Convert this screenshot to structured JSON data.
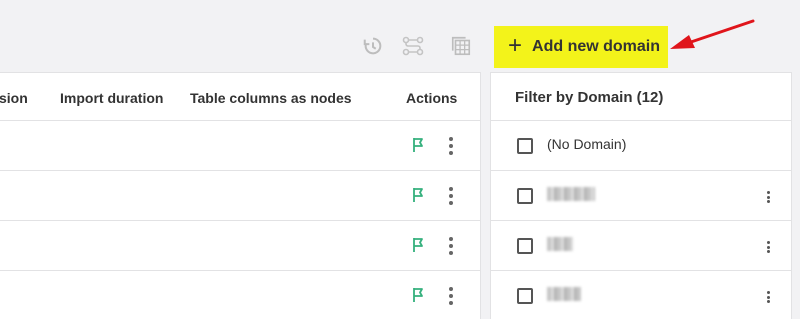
{
  "toolbar": {
    "icons": [
      "history-icon",
      "schema-icon",
      "grid-icon"
    ],
    "add_domain_label": "Add new domain",
    "accent": "#f3f31a",
    "annotation_arrow_color": "#e0151b"
  },
  "table": {
    "columns": [
      "sion",
      "Import duration",
      "Table columns as nodes",
      "Actions"
    ],
    "rows": 4,
    "flag_color": "#35b07d"
  },
  "filter": {
    "title": "Filter by Domain (12)",
    "items": [
      {
        "label": "(No Domain)",
        "checked": false,
        "redacted": false
      },
      {
        "label": "",
        "checked": false,
        "redacted": true
      },
      {
        "label": "",
        "checked": false,
        "redacted": true
      },
      {
        "label": "",
        "checked": false,
        "redacted": true
      }
    ]
  }
}
